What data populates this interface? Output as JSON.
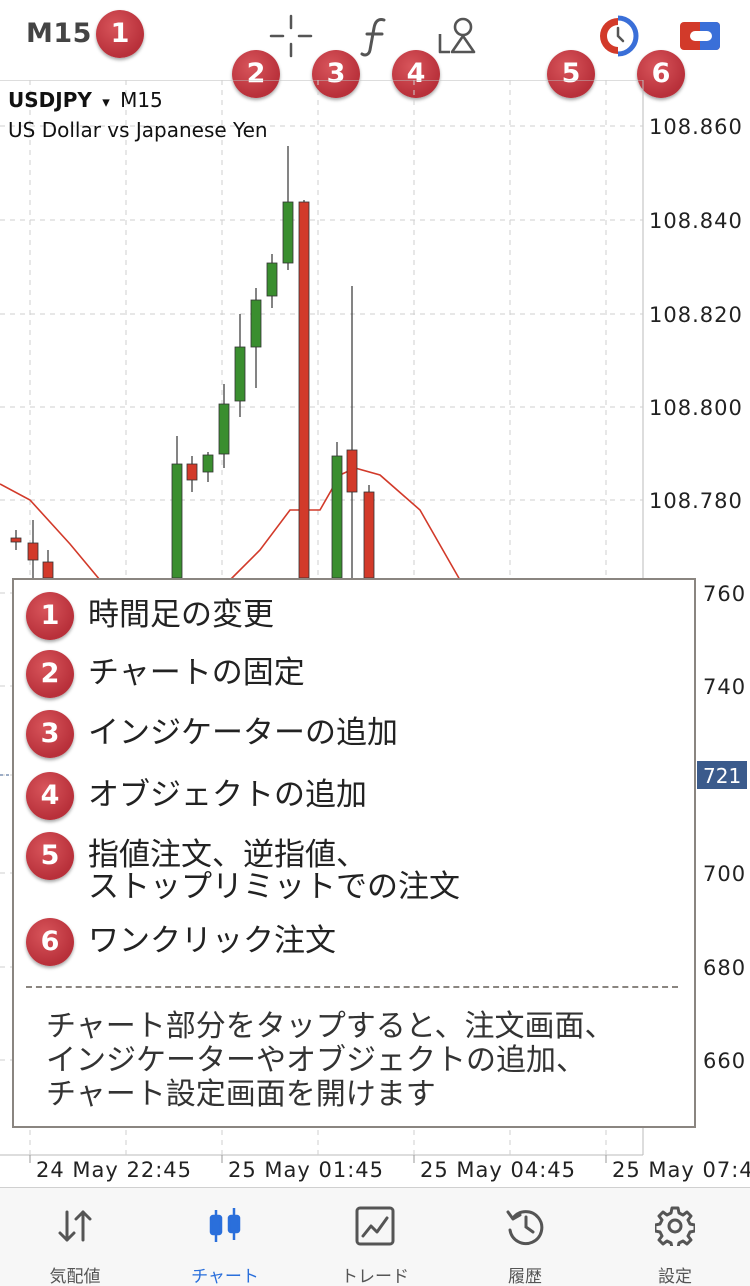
{
  "toolbar": {
    "period": "M15",
    "icons": [
      "crosshair-icon",
      "function-icon",
      "objects-icon",
      "pending-order-icon",
      "one-click-trading-icon"
    ],
    "badges": [
      "1",
      "2",
      "3",
      "4",
      "5",
      "6"
    ]
  },
  "chart": {
    "symbol": "USDJPY",
    "dropdown_glyph": "▾",
    "period": "M15",
    "description": "US Dollar vs Japanese Yen",
    "price_labels": [
      "108.860",
      "108.840",
      "108.820",
      "108.800",
      "108.780",
      "760",
      "740",
      "721",
      "700",
      "680",
      "660"
    ],
    "current_price": "721",
    "time_labels": [
      "24 May 22:45",
      "25 May 01:45",
      "25 May 04:45",
      "25 May 07:4"
    ],
    "colors": {
      "bull": "#3a8e2f",
      "bear": "#d23a2a",
      "ma": "#d23a2a",
      "grid": "#cfcfcf",
      "price_tag": "#3b5b8c"
    }
  },
  "legend": {
    "items": [
      {
        "badge": "1",
        "text": "時間足の変更"
      },
      {
        "badge": "2",
        "text": "チャートの固定"
      },
      {
        "badge": "3",
        "text": "インジケーターの追加"
      },
      {
        "badge": "4",
        "text": "オブジェクトの追加"
      },
      {
        "badge": "5",
        "text": "指値注文、逆指値、",
        "text2": "ストップリミットでの注文"
      },
      {
        "badge": "6",
        "text": "ワンクリック注文"
      }
    ],
    "note": [
      "チャート部分をタップすると、注文画面、",
      "インジケーターやオブジェクトの追加、",
      "チャート設定画面を開けます"
    ]
  },
  "tabs": [
    {
      "label": "気配値",
      "icon": "quotes-arrows-icon"
    },
    {
      "label": "チャート",
      "icon": "candlestick-icon",
      "active": true
    },
    {
      "label": "トレード",
      "icon": "trade-chart-icon"
    },
    {
      "label": "履歴",
      "icon": "history-clock-icon"
    },
    {
      "label": "設定",
      "icon": "settings-gear-icon"
    }
  ]
}
